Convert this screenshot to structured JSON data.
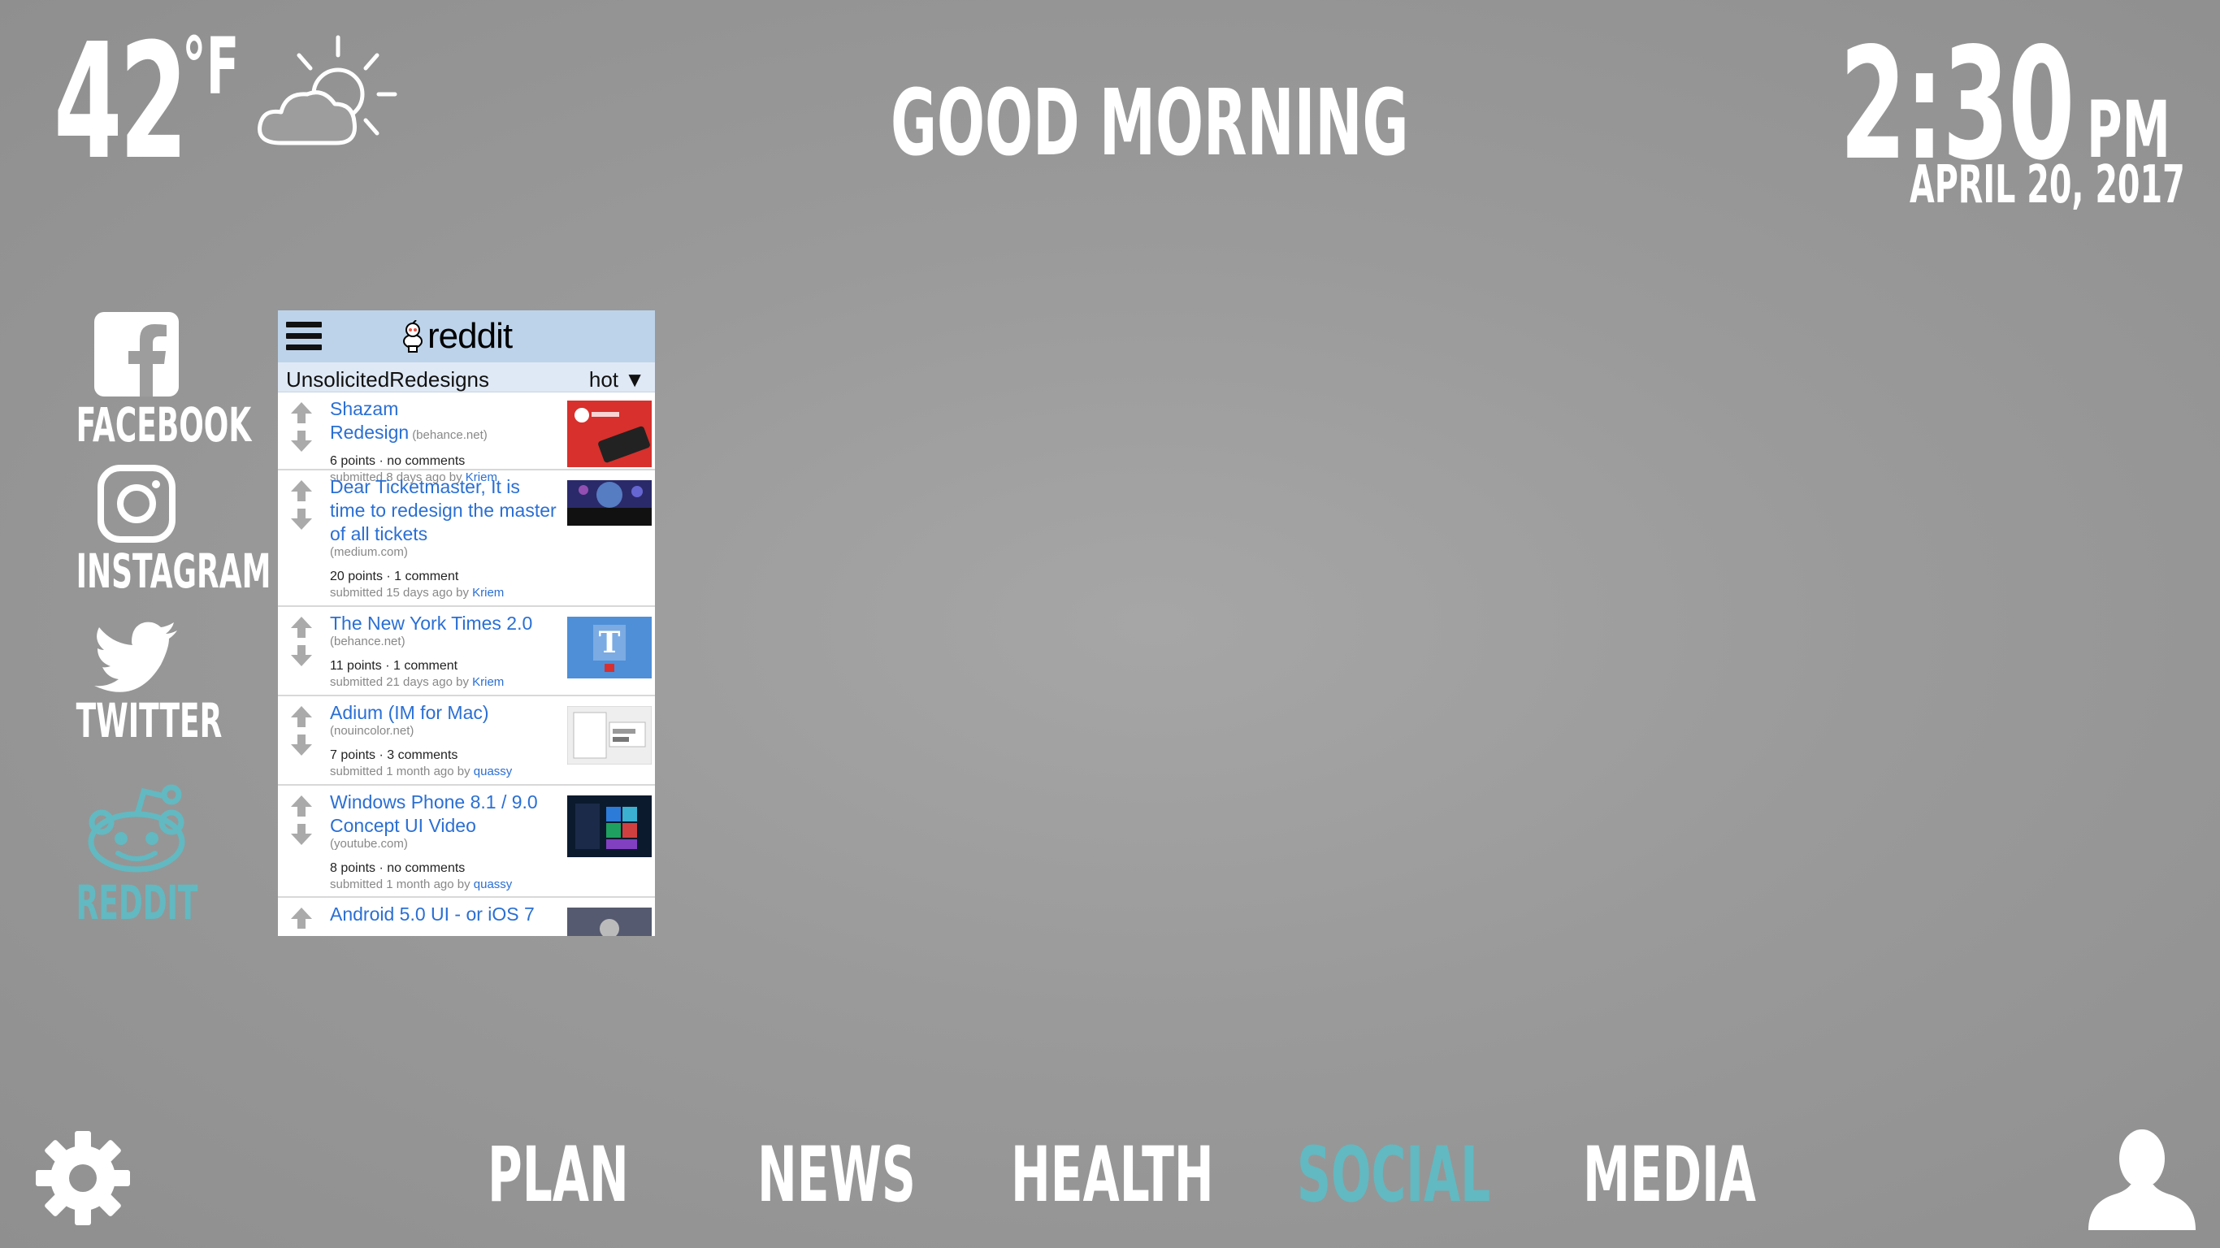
{
  "weather": {
    "temperature": "42",
    "unit": "°F",
    "icon": "partly-cloudy-icon"
  },
  "greeting": "GOOD MORNING",
  "clock": {
    "time": "2:30",
    "ampm": "PM",
    "date": "APRIL 20, 2017"
  },
  "sidebar": {
    "items": [
      {
        "label": "FACEBOOK",
        "icon": "facebook-icon"
      },
      {
        "label": "INSTAGRAM",
        "icon": "instagram-icon"
      },
      {
        "label": "TWITTER",
        "icon": "twitter-icon"
      },
      {
        "label": "REDDIT",
        "icon": "reddit-icon",
        "active": true
      }
    ],
    "active_color": "#62b9c1"
  },
  "reddit": {
    "logo_text": "reddit",
    "subreddit": "UnsolicitedRedesigns",
    "sort": "hot",
    "posts": [
      {
        "title": "Shazam Redesign",
        "domain": "(behance.net)",
        "meta": "6 points · no comments",
        "submitted": "submitted 8 days ago by",
        "author": "Kriem"
      },
      {
        "title": "Dear Ticketmaster, It is time to redesign the master of all tickets",
        "domain": "(medium.com)",
        "meta": "20 points · 1 comment",
        "submitted": "submitted 15 days ago by",
        "author": "Kriem"
      },
      {
        "title": "The New York Times 2.0",
        "domain": "(behance.net)",
        "meta": "11 points · 1 comment",
        "submitted": "submitted 21 days ago by",
        "author": "Kriem"
      },
      {
        "title": "Adium (IM for Mac)",
        "domain": "(nouincolor.net)",
        "meta": "7 points · 3 comments",
        "submitted": "submitted 1 month ago by",
        "author": "quassy"
      },
      {
        "title": "Windows Phone 8.1 / 9.0 Concept UI Video",
        "domain": "(youtube.com)",
        "meta": "8 points · no comments",
        "submitted": "submitted 1 month ago by",
        "author": "quassy"
      },
      {
        "title": "Android 5.0 UI - or iOS 7",
        "domain": "",
        "meta": "",
        "submitted": "",
        "author": ""
      }
    ],
    "header_color": "#bdd3ea",
    "link_color": "#2a6fd4"
  },
  "nav": {
    "tabs": [
      {
        "label": "PLAN"
      },
      {
        "label": "NEWS"
      },
      {
        "label": "HEALTH"
      },
      {
        "label": "SOCIAL",
        "active": true
      },
      {
        "label": "MEDIA"
      }
    ]
  },
  "icons": {
    "settings": "gear-icon",
    "profile": "user-icon"
  }
}
